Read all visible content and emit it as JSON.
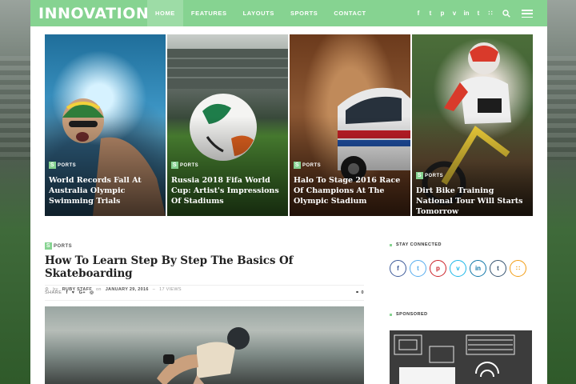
{
  "brand": {
    "name": "INNOVATION"
  },
  "nav": {
    "items": [
      "HOME",
      "FEATURES",
      "LAYOUTS",
      "SPORTS",
      "CONTACT"
    ],
    "active_index": 0
  },
  "social_icons": [
    "facebook-icon",
    "twitter-icon",
    "pinterest-icon",
    "vimeo-icon",
    "linkedin-icon",
    "tumblr-icon",
    "rss-icon"
  ],
  "social_glyphs": [
    "f",
    "t",
    "p",
    "v",
    "in",
    "t",
    "∷"
  ],
  "hero_cards": [
    {
      "category": "PORTS",
      "title": "World Records Fall At Australia Olympic Swimming Trials"
    },
    {
      "category": "PORTS",
      "title": "Russia 2018 Fifa World Cup: Artist's Impressions Of Stadiums"
    },
    {
      "category": "PORTS",
      "title": "Halo To Stage 2016 Race Of Champions At The Olympic Stadium"
    },
    {
      "category": "PORTS",
      "title": "Dirt Bike Training National Tour Will Starts Tomorrow"
    }
  ],
  "post": {
    "category": "PORTS",
    "title": "How To Learn Step By Step The Basics Of Skateboarding",
    "meta": {
      "by": "by",
      "author": "RUBY STAFF",
      "on": "on",
      "date": "JANUARY 29, 2016",
      "separator": "–",
      "views": "17 VIEWS"
    },
    "share_label": "SHARE",
    "share_glyphs": [
      "f",
      "♥",
      "G+",
      "◎"
    ],
    "comments": "0"
  },
  "sidebar": {
    "stay_connected_title": "STAY CONNECTED",
    "sponsored_title": "SPONSORED",
    "circle_glyphs": [
      "f",
      "t",
      "p",
      "v",
      "in",
      "t",
      "∷"
    ],
    "circle_colors": [
      "#3b5998",
      "#55acee",
      "#cb2027",
      "#1ab7ea",
      "#0e76a8",
      "#34526f",
      "#f39c12"
    ]
  },
  "colors": {
    "accent": "#86d391"
  }
}
